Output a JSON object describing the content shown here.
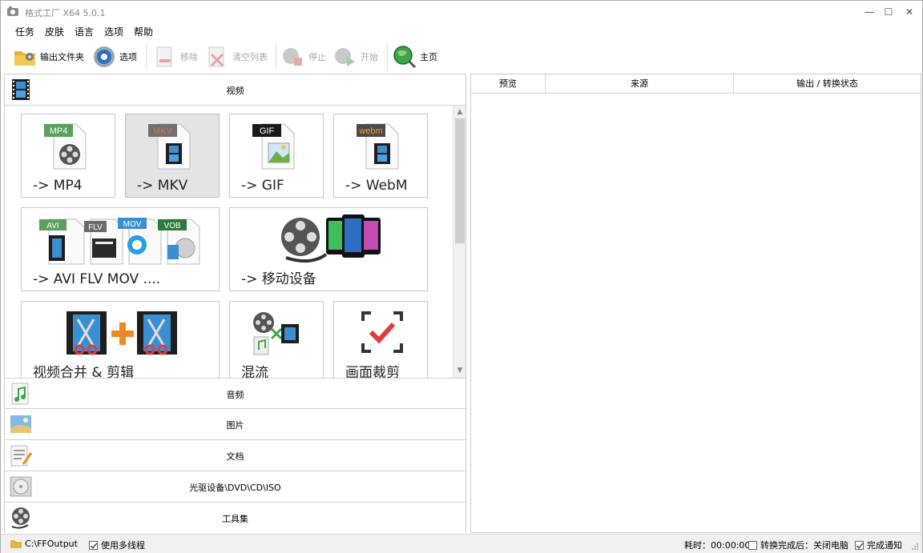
{
  "window": {
    "title": "格式工厂 X64 5.0.1",
    "minimize_glyph": "—",
    "maximize_glyph": "☐",
    "close_glyph": "✕"
  },
  "menu": [
    "任务",
    "皮肤",
    "语言",
    "选项",
    "帮助"
  ],
  "toolbar": {
    "output_folder": "输出文件夹",
    "options": "选项",
    "remove": "移除",
    "clear_list": "清空列表",
    "stop": "停止",
    "start": "开始",
    "home": "主页"
  },
  "categories": {
    "video": "视频",
    "audio": "音频",
    "image": "图片",
    "document": "文档",
    "disc": "光驱设备\\DVD\\CD\\ISO",
    "tools": "工具集"
  },
  "video_tiles": {
    "mp4": "-> MP4",
    "mkv": "-> MKV",
    "gif": "-> GIF",
    "webm": "-> WebM",
    "avi": "-> AVI FLV MOV ....",
    "mobile": "-> 移动设备",
    "merge": "视频合并 & 剪辑",
    "mux": "混流",
    "crop": "画面裁剪"
  },
  "badges": {
    "mp4": "MP4",
    "mkv": "MKV",
    "gif": "GIF",
    "webm": "webm",
    "avi": "AVI",
    "flv": "FLV",
    "mov": "MOV",
    "vob": "VOB"
  },
  "table_headers": [
    "预览",
    "来源",
    "输出 / 转换状态"
  ],
  "status": {
    "output_path": "C:\\FFOutput",
    "multithread": "使用多线程",
    "elapsed": "耗时：00:00:00",
    "after_done": "转换完成后：关闭电脑",
    "notify": "完成通知"
  },
  "colors": {
    "mp4_badge": "#5aa05a",
    "mkv_badge": "#e0734a",
    "gif_badge": "#1a1a1a",
    "webm_badge": "#4a4a4a",
    "accent_red": "#e23b3b",
    "status_bar": "#f0f0f0"
  }
}
